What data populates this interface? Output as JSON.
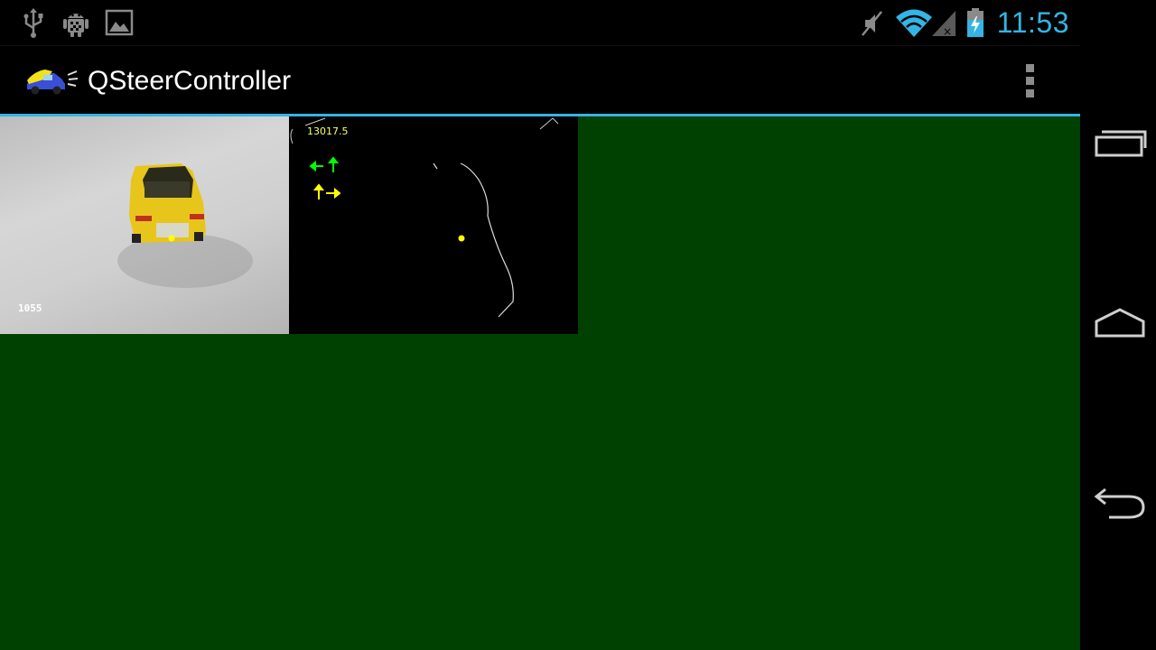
{
  "status_bar": {
    "icons": [
      "usb-icon",
      "android-debug-icon",
      "gallery-icon",
      "mute-icon",
      "wifi-icon",
      "signal-icon",
      "battery-icon"
    ],
    "time": "11:53",
    "accent_color": "#33b5e5"
  },
  "action_bar": {
    "app_icon": "car-icon",
    "title": "QSteerController",
    "overflow_icon": "overflow-menu-icon"
  },
  "main": {
    "background_color": "#004000",
    "camera_view": {
      "frame_label": "1055"
    },
    "edge_view": {
      "value_label": "13017.5",
      "indicators": [
        {
          "name": "left-forward-arrows",
          "color": "#00ff00"
        },
        {
          "name": "forward-right-arrows",
          "color": "#ffff00"
        }
      ]
    }
  },
  "navigation_bar": {
    "buttons": [
      "recent-apps-icon",
      "home-icon",
      "back-icon"
    ]
  }
}
